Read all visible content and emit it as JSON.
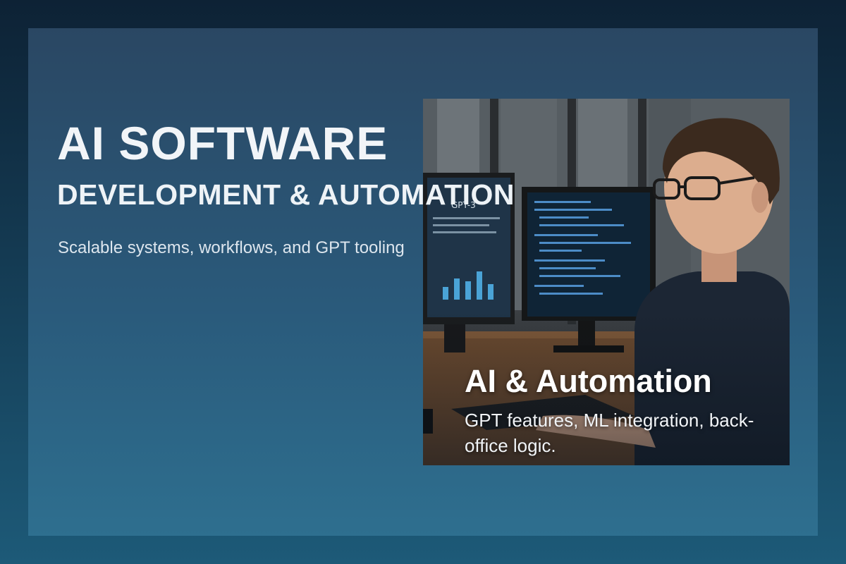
{
  "hero": {
    "title": "AI SOFTWARE",
    "subtitle": "DEVELOPMENT & AUTOMATION",
    "tagline": "Scalable systems, workflows, and GPT tooling"
  },
  "feature_card": {
    "title": "AI & Automation",
    "description": "GPT features, ML integration, back-office logic.",
    "monitor_label": "GPT-3"
  },
  "colors": {
    "background_top": "#0d2235",
    "background_bottom": "#1d5a78",
    "panel": "#2a5a7b",
    "text": "#f2f5f8",
    "chart_bars": "#4aa3d6"
  }
}
